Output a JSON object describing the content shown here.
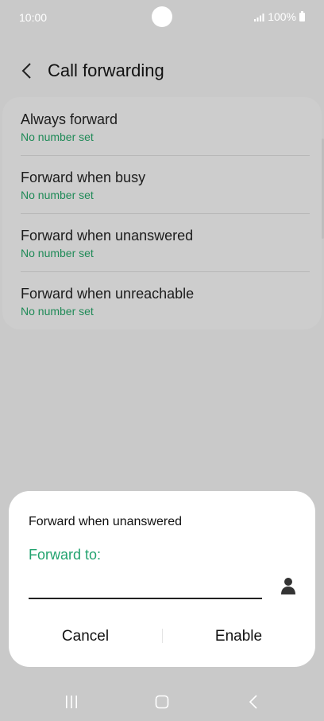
{
  "status_bar": {
    "time": "10:00",
    "battery": "100%"
  },
  "header": {
    "title": "Call forwarding"
  },
  "options": [
    {
      "title": "Always forward",
      "subtitle": "No number set"
    },
    {
      "title": "Forward when busy",
      "subtitle": "No number set"
    },
    {
      "title": "Forward when unanswered",
      "subtitle": "No number set"
    },
    {
      "title": "Forward when unreachable",
      "subtitle": "No number set"
    }
  ],
  "dialog": {
    "title": "Forward when unanswered",
    "field_label": "Forward to:",
    "input_value": "",
    "cancel_label": "Cancel",
    "enable_label": "Enable"
  },
  "colors": {
    "accent": "#1f8a57",
    "dim_background": "#c9c9c9",
    "dialog_background": "#ffffff"
  },
  "icons": [
    "back-arrow-icon",
    "contact-icon",
    "recents-icon",
    "home-icon",
    "back-icon",
    "signal-icon",
    "battery-icon"
  ]
}
